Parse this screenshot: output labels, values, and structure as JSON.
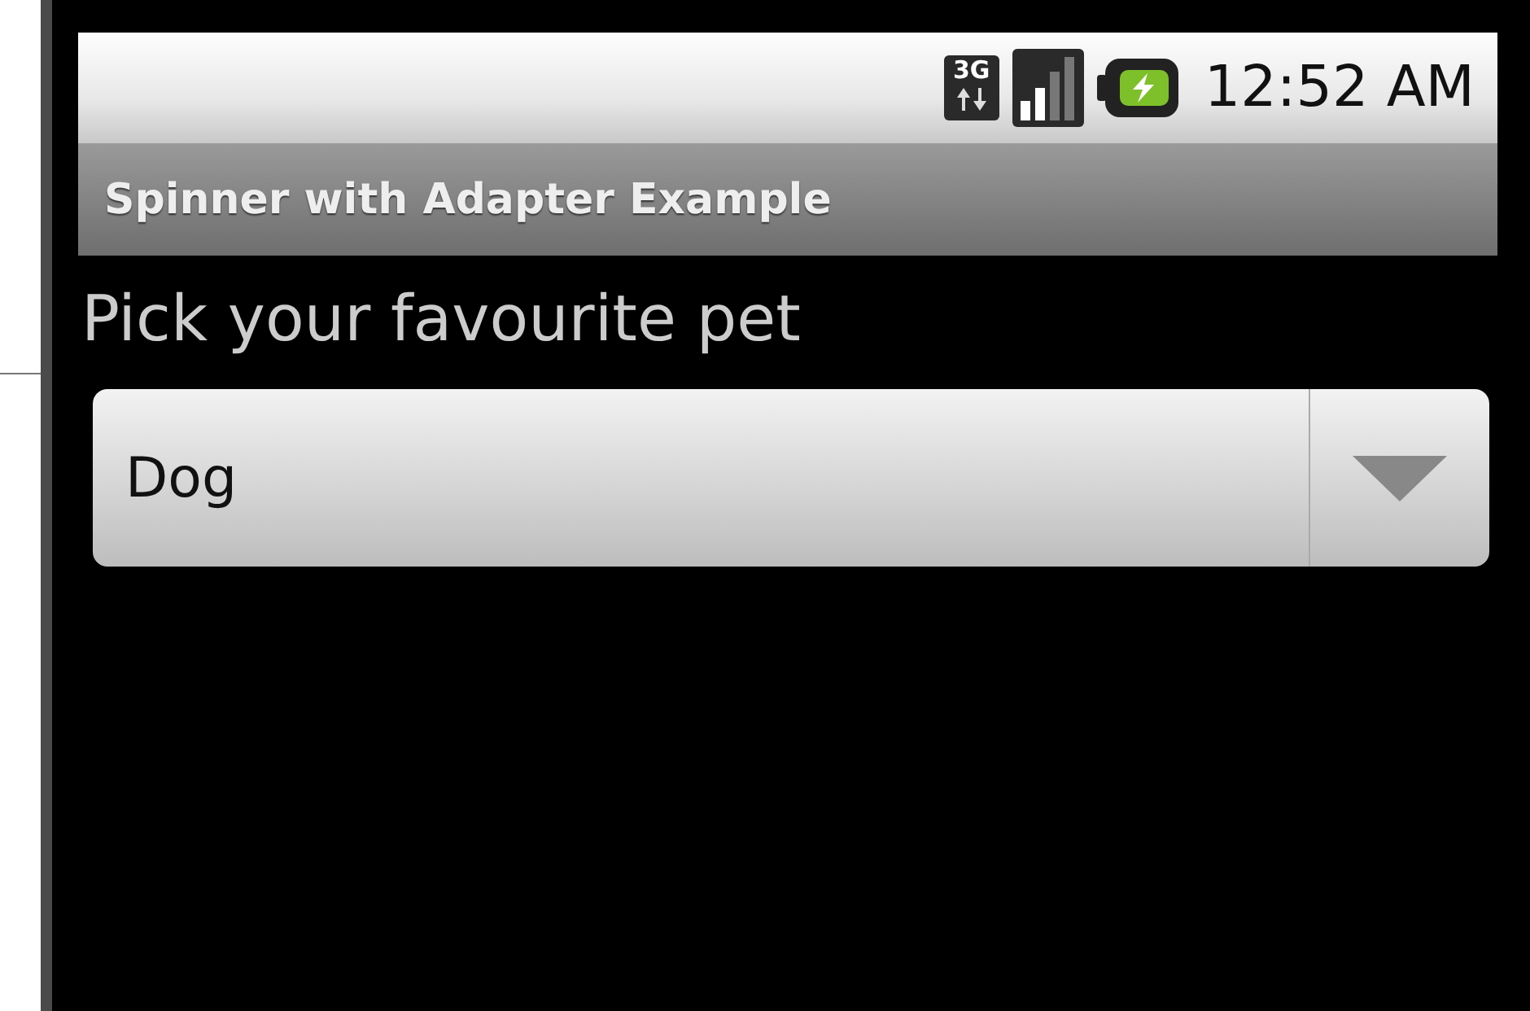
{
  "status_bar": {
    "network": "3G",
    "time": "12:52 AM"
  },
  "title_bar": {
    "title": "Spinner with Adapter Example"
  },
  "prompt": "Pick your favourite pet",
  "spinner": {
    "value": "Dog"
  }
}
